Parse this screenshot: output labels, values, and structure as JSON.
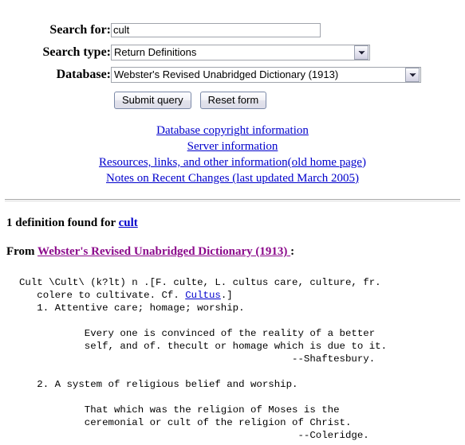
{
  "form": {
    "fields": [
      {
        "label": "Search for:",
        "type": "text",
        "value": "cult",
        "placeholder": ""
      },
      {
        "label": "Search type:",
        "type": "select",
        "value": "Return Definitions"
      },
      {
        "label": "Database:",
        "type": "select",
        "value": "Webster's Revised Unabridged Dictionary (1913)"
      }
    ],
    "submit_label": "Submit query",
    "reset_label": "Reset form"
  },
  "nav_links": {
    "copyright": "Database copyright information",
    "server": "Server information",
    "resources": "Resources, links, and other information",
    "resources_suffix_open": "(",
    "resources_old_home": "old home page",
    "resources_suffix_close": ")",
    "notes": "Notes on Recent Changes (last updated March 2005)"
  },
  "results": {
    "found_prefix": "1 definition found for ",
    "found_term": "cult",
    "from_prefix": "From ",
    "from_source": "Webster's Revised Unabridged Dictionary (1913) ",
    "from_suffix": ":",
    "definition_part1": "Cult \\Cult\\ (k?lt) n .[F. culte, L. cultus care, culture, fr.\n   colere to cultivate. Cf. ",
    "definition_link": "Cultus",
    "definition_part2": ".]\n   1. Attentive care; homage; worship.\n\n           Every one is convinced of the reality of a better\n           self, and of. thecult or homage which is due to it.\n                                              --Shaftesbury.\n\n   2. A system of religious belief and worship.\n\n           That which was the religion of Moses is the\n           ceremonial or cult of the religion of Christ.\n                                               --Coleridge."
  },
  "colors": {
    "link": "#0000cc",
    "visited_link": "#8b0a8b",
    "text": "#000000",
    "background": "#ffffff"
  }
}
